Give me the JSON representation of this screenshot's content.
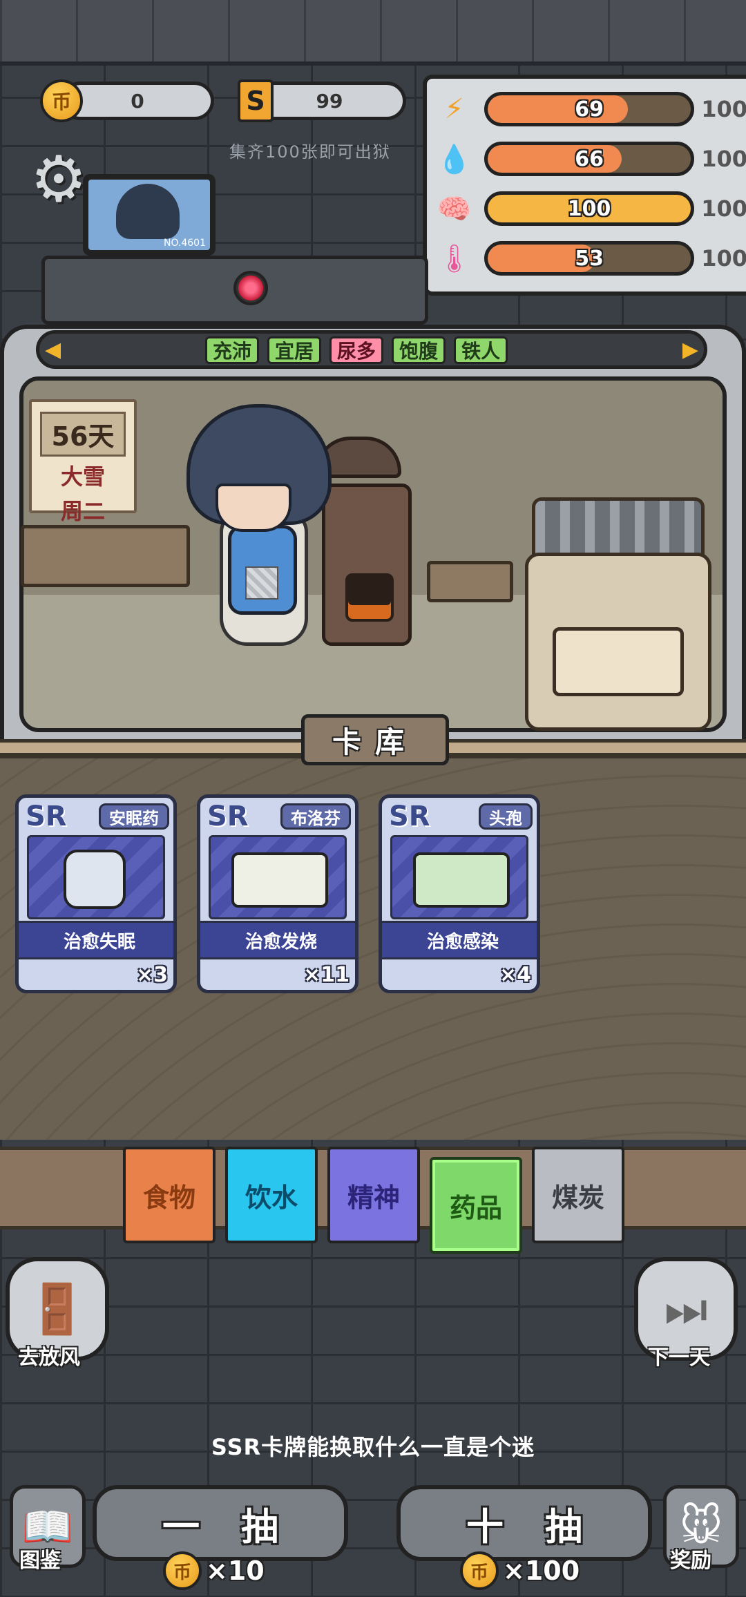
{
  "currency": {
    "coins": "0",
    "coin_glyph": "币",
    "s_points": "99",
    "s_glyph": "S",
    "hint": "集齐100张即可出狱"
  },
  "stats": [
    {
      "icon": "lightning-icon",
      "glyph": "⚡",
      "value": "69",
      "max": "100",
      "level": 0.69,
      "color": "#f08a50"
    },
    {
      "icon": "water-drop-icon",
      "glyph": "💧",
      "value": "66",
      "max": "100",
      "level": 0.66,
      "color": "#f08a50"
    },
    {
      "icon": "brain-icon",
      "glyph": "🧠",
      "value": "100",
      "max": "100",
      "level": 1.0,
      "color": "#f6b644"
    },
    {
      "icon": "thermometer-icon",
      "glyph": "🌡",
      "value": "53",
      "max": "100",
      "level": 0.53,
      "color": "#f08a50"
    }
  ],
  "monitor": {
    "number": "NO.4601"
  },
  "tags": [
    "充沛",
    "宜居",
    "尿多",
    "饱腹",
    "铁人"
  ],
  "calendar": {
    "day": "56天",
    "weather": "大雪",
    "weekday": "周二"
  },
  "library": {
    "title": "卡库"
  },
  "cards": [
    {
      "rank": "SR",
      "name": "安眠药",
      "effect": "治愈失眠",
      "count": "×3"
    },
    {
      "rank": "SR",
      "name": "布洛芬",
      "effect": "治愈发烧",
      "count": "×11"
    },
    {
      "rank": "SR",
      "name": "头孢",
      "effect": "治愈感染",
      "count": "×4"
    }
  ],
  "categories": [
    {
      "label": "食物",
      "color": "#e9824a",
      "text": "#8a3a10"
    },
    {
      "label": "饮水",
      "color": "#29c6f0",
      "text": "#0b4c6b"
    },
    {
      "label": "精神",
      "color": "#7b73e0",
      "text": "#2b2478"
    },
    {
      "label": "药品",
      "color": "#7ed86a",
      "text": "#1f5a14"
    },
    {
      "label": "煤炭",
      "color": "#b9bcc2",
      "text": "#3b3e44"
    }
  ],
  "buttons": {
    "go_out": "去放风",
    "next_day": "下一天",
    "tip": "SSR卡牌能换取什么一直是个迷",
    "draw_one": "一抽",
    "draw_ten": "十抽",
    "draw_one_cost": "×10",
    "draw_ten_cost": "×100",
    "codex": "图鉴",
    "reward": "奖励"
  }
}
